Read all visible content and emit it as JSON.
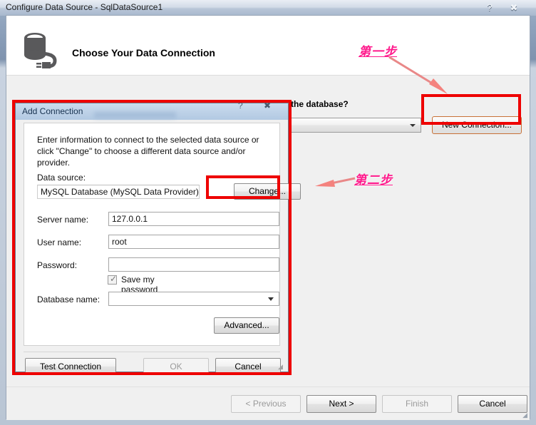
{
  "window": {
    "title": "Configure Data Source - SqlDataSource1",
    "help_icon": "help-icon",
    "close_icon": "close-icon",
    "help_glyph": "?",
    "close_glyph": "✖"
  },
  "header": {
    "title": "Choose Your Data Connection",
    "icon": "database-connection-icon"
  },
  "main": {
    "question": "Which data connection should your application use to connect to the database?",
    "connection_combo_value": "",
    "new_connection_button": "New Connection..."
  },
  "dialog": {
    "title": "Add Connection",
    "help_glyph": "?",
    "close_glyph": "✖",
    "intro": "Enter information to connect to the selected data source or click \"Change\" to choose a different data source and/or provider.",
    "data_source_label": "Data source:",
    "data_source_value": "MySQL Database (MySQL Data Provider)",
    "change_button": "Change...",
    "server_name_label": "Server name:",
    "server_name_value": "127.0.0.1",
    "user_name_label": "User name:",
    "user_name_value": "root",
    "password_label": "Password:",
    "password_value": "",
    "save_password_label": "Save my password",
    "save_password_checked": true,
    "save_password_tick": "✓",
    "database_name_label": "Database name:",
    "database_name_value": "",
    "advanced_button": "Advanced...",
    "test_connection_button": "Test Connection",
    "ok_button": "OK",
    "cancel_button": "Cancel",
    "resize_grip": "◢"
  },
  "footer": {
    "previous_button": "< Previous",
    "next_button": "Next >",
    "finish_button": "Finish",
    "cancel_button": "Cancel",
    "resize_grip": "◢"
  },
  "annotations": {
    "step1": "第一步",
    "step2": "第二步",
    "highlight_color": "#ee0000",
    "annotation_color": "#ff1a8c",
    "arrow_color": "#e98080"
  }
}
